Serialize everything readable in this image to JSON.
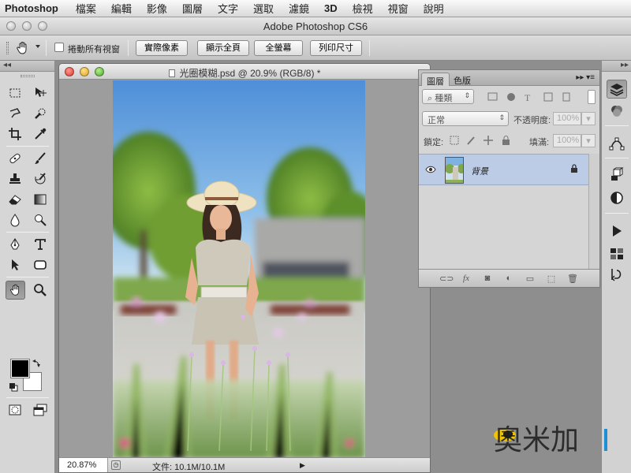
{
  "menubar": {
    "app": "Photoshop",
    "items": [
      "檔案",
      "編輯",
      "影像",
      "圖層",
      "文字",
      "選取",
      "濾鏡",
      "3D",
      "檢視",
      "視窗",
      "說明"
    ]
  },
  "window": {
    "title": "Adobe Photoshop CS6"
  },
  "options": {
    "scroll_all_label": "捲動所有視窗",
    "buttons": [
      "實際像素",
      "顯示全頁",
      "全螢幕",
      "列印尺寸"
    ]
  },
  "document": {
    "tab_title": "光圈模糊.psd @ 20.9% (RGB/8) *",
    "zoom": "20.87%",
    "doc_size": "文件: 10.1M/10.1M"
  },
  "layers_panel": {
    "tabs": [
      "圖層",
      "色版"
    ],
    "filter_kind": "種類",
    "blend_mode": "正常",
    "opacity_label": "不透明度:",
    "opacity_value": "100%",
    "lock_label": "鎖定:",
    "fill_label": "填滿:",
    "fill_value": "100%",
    "layers": [
      {
        "name": "背景",
        "visible": true,
        "locked": true
      }
    ]
  },
  "colors": {
    "foreground": "#000000",
    "background": "#ffffff",
    "selected_layer": "#bccbe6"
  },
  "watermark": {
    "text": "奧米加"
  }
}
